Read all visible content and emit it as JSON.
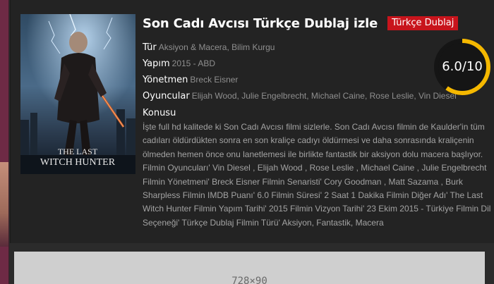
{
  "movie": {
    "title": "Son Cadı Avcısı Türkçe Dublaj izle",
    "badge": "Türkçe Dublaj",
    "poster_title_line1": "THE LAST",
    "poster_title_line2": "WITCH HUNTER",
    "rating": "6.0/10",
    "rating_fraction": 0.6,
    "accent_color": "#f5b800",
    "badge_color": "#c8141c"
  },
  "meta": {
    "genre_label": "Tür",
    "genre_value": "Aksiyon & Macera, Bilim Kurgu",
    "year_label": "Yapım",
    "year_value": "2015 - ABD",
    "director_label": "Yönetmen",
    "director_value": "Breck Eisner",
    "cast_label": "Oyuncular",
    "cast_value": "Elijah Wood, Julie Engelbrecht, Michael Caine, Rose Leslie, Vin Diesel",
    "plot_label": "Konusu"
  },
  "description": "İşte full hd kalitede ki Son Cadı Avcısı filmi sizlerle. Son Cadı Avcısı filmin de Kaulder'in tüm cadıları öldürdükten sonra en son kraliçe cadıyı öldürmesi ve daha sonrasında kraliçenin ölmeden hemen önce onu lanetlemesi ile birlikte fantastik bir aksiyon dolu macera başlıyor. Filmin Oyuncuları' Vin Diesel , Elijah Wood , Rose Leslie , Michael Caine , Julie Engelbrecht Filmin Yönetmeni' Breck Eisner Filmin Senaristi' Cory Goodman , Matt Sazama , Burk Sharpless Filmin IMDB Puanı' 6.0 Filmin Süresi' 2 Saat 1 Dakika Filmin Diğer Adı' The Last Witch Hunter Filmin Yapım Tarihi' 2015 Filmin Vizyon Tarihi' 23 Ekim 2015 - Türkiye Filmin Dil Seçeneği' Türkçe Dublaj Filmin Türü' Aksiyon, Fantastik, Macera",
  "ad": {
    "label": "728×90"
  }
}
